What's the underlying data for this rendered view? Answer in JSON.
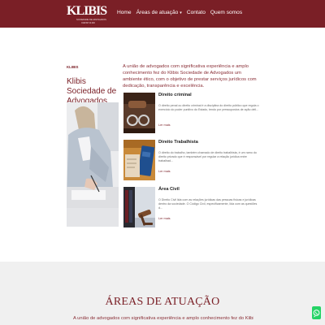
{
  "header": {
    "logo_text": "KLIBIS",
    "logo_tagline1": "SOCIEDADE DE ADVOGADOS",
    "logo_tagline2": "OAB/SP 00.000",
    "nav": [
      {
        "label": "Home"
      },
      {
        "label": "Áreas de atuação",
        "has_dropdown": true
      },
      {
        "label": "Contato"
      },
      {
        "label": "Quem somos"
      }
    ],
    "dropdown_glyph": "▾"
  },
  "sidebar": {
    "small_label": "KLIBIS",
    "title": "Klibis Sociedade de Advogados"
  },
  "intro_text": "A união de advogados com significativa experiência e amplo conhecimento fez do Klibis Sociedade de Advogados um ambiente ético, com o objetivo de prestar serviços jurídicos com dedicação, transparência e excelência.",
  "cards": [
    {
      "title": "Direito criminal",
      "text": "O direito penal ou direito criminal é a disciplina do direito público que regula o exercício do poder punitivo do Estado, tendo por pressupostos de ação deli...",
      "more": "Ler mais",
      "image_icon": "handcuffs-gavel-photo"
    },
    {
      "title": "Direito Trabalhista",
      "text": "O direito do trabalho, também chamado de direito trabalhista, é um ramo do direito privado que é responsável por regular a relação jurídica entre trabalhad...",
      "more": "Ler mais",
      "image_icon": "work-card-photo"
    },
    {
      "title": "Área Civil",
      "text": "O Direito Civil lida com as relações jurídicas das pessoas físicas e jurídicas dentro da sociedade. O Código Civil, especificamente, lida com as questões d...",
      "more": "Ler mais",
      "image_icon": "gavel-books-photo"
    }
  ],
  "section": {
    "title": "ÁREAS DE ATUAÇÃO",
    "text": "A união de advogados com significativa experiência e amplo conhecimento fez do Klibis Sociedade de"
  },
  "colors": {
    "brand": "#7a1f26",
    "text_red": "#8a2f37",
    "band_bg": "#f0f0f0",
    "whatsapp": "#25d366"
  }
}
